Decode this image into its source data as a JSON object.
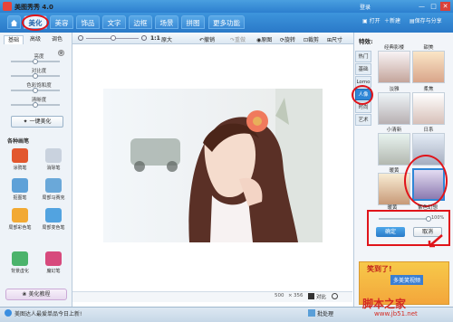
{
  "app": {
    "title": "美图秀秀 4.0",
    "login": "登录"
  },
  "window": {
    "minimize": "—",
    "maximize": "□",
    "close": "✕"
  },
  "tabs": [
    {
      "label": "美化",
      "active": true
    },
    {
      "label": "美容"
    },
    {
      "label": "饰品"
    },
    {
      "label": "文字"
    },
    {
      "label": "边框"
    },
    {
      "label": "场景"
    },
    {
      "label": "拼图"
    },
    {
      "label": "更多功能"
    }
  ],
  "toolbar_right": {
    "open": "打开",
    "new": "新建",
    "save": "保存与分享"
  },
  "subbar": {
    "zoom": "1:1",
    "fit": "原大",
    "undo": "撤销",
    "redo": "重做",
    "original": "原图",
    "rotate": "旋转",
    "crop": "裁剪",
    "size": "尺寸"
  },
  "left_tabs": [
    "基础",
    "高级",
    "调色"
  ],
  "sliders": [
    {
      "label": "亮度",
      "value": 0.5
    },
    {
      "label": "对比度",
      "value": 0.5
    },
    {
      "label": "色彩饱和度",
      "value": 0.5
    },
    {
      "label": "清晰度",
      "value": 0.5
    }
  ],
  "one_click": "一键美化",
  "brush_title": "各种画笔",
  "tools": [
    {
      "label": "涂鸦笔",
      "color": "#e2572e"
    },
    {
      "label": "消除笔",
      "color": "#c9d2de"
    },
    {
      "label": "抠图笔",
      "color": "#5ea1d8"
    },
    {
      "label": "局部马赛克",
      "color": "#6aa8d9"
    },
    {
      "label": "局部彩色笔",
      "color": "#f2a933"
    },
    {
      "label": "局部变色笔",
      "color": "#52a3e0"
    },
    {
      "label": "背景虚化",
      "color": "#4bb36b"
    },
    {
      "label": "魔幻笔",
      "color": "#d74a7d"
    }
  ],
  "tutorial": "美化教程",
  "right_panel": {
    "title": "特效:",
    "categories": [
      "热门",
      "基础",
      "Lomo",
      "人像",
      "时尚",
      "艺术"
    ],
    "active_category": "人像",
    "effects": [
      "经典影楼",
      "甜美",
      "淡雅",
      "柔焦",
      "小清新",
      "日系",
      "暖黄",
      "紫色幻想"
    ],
    "opacity": "100%",
    "apply": "确定",
    "cancel": "取消"
  },
  "ad": {
    "title": "笑到了!",
    "subtitle": "多美笑视频"
  },
  "canvas_bottom": {
    "width": "500",
    "height": "356",
    "compare": "对比",
    "zoom_icon": "magnifier"
  },
  "status": {
    "message": "美图达人最爱单品今日上新!",
    "batch": "批处理",
    "watermark": "脚本之家",
    "url": "www.jb51.net"
  }
}
